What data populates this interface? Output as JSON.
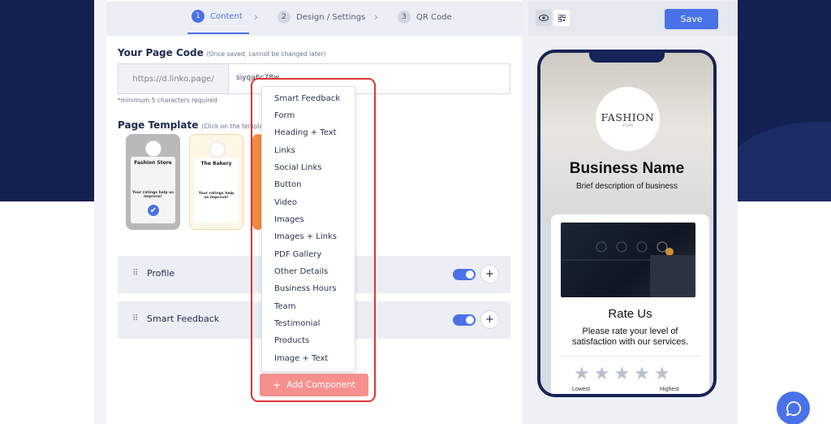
{
  "steps": [
    {
      "num": "1",
      "label": "Content"
    },
    {
      "num": "2",
      "label": "Design / Settings"
    },
    {
      "num": "3",
      "label": "QR Code"
    }
  ],
  "page_code": {
    "title": "Your Page Code",
    "note": "(Once saved, cannot be changed later)",
    "prefix": "https://d.linko.page/",
    "value": "siyqa6c78w",
    "hint": "*minimum 5 characters required"
  },
  "template": {
    "title": "Page Template",
    "note": "(Click on the template",
    "items": [
      {
        "title": "Fashion Store",
        "text": "Your ratings help us improve!"
      },
      {
        "title": "The Bakery",
        "text": "Your ratings help us improve!"
      }
    ]
  },
  "components": [
    {
      "label": "Profile"
    },
    {
      "label": "Smart Feedback"
    }
  ],
  "dropdown": {
    "items": [
      "Smart Feedback",
      "Form",
      "Heading + Text",
      "Links",
      "Social Links",
      "Button",
      "Video",
      "Images",
      "Images + Links",
      "PDF Gallery",
      "Other Details",
      "Business Hours",
      "Team",
      "Testimonial",
      "Products",
      "Image + Text"
    ]
  },
  "add_component_label": "Add Component",
  "toolbar": {
    "save_label": "Save"
  },
  "preview": {
    "logo_text": "FASHION",
    "logo_sub": "STORE",
    "business_name": "Business Name",
    "business_desc": "Brief description of business",
    "rate_title": "Rate Us",
    "rate_desc": "Please rate your level of satisfaction with our services.",
    "stars": "★★★★★",
    "low_label": "Lowest",
    "high_label": "Highest"
  },
  "colors": {
    "accent": "#4a72e8",
    "navy": "#132050",
    "add_button": "#f6908e",
    "highlight": "#e03535"
  }
}
